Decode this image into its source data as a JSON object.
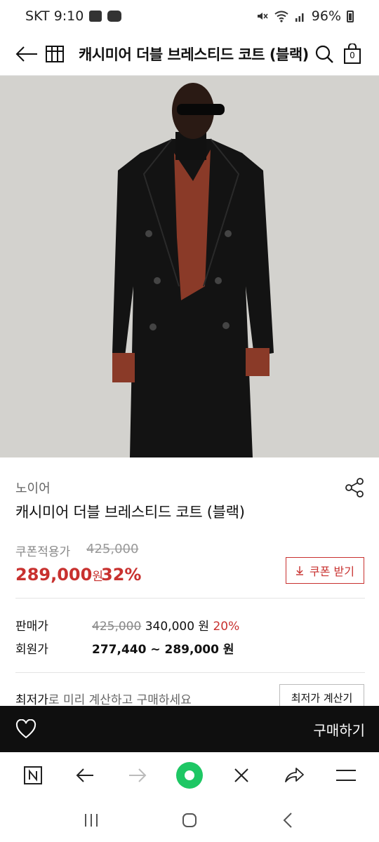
{
  "status_bar": {
    "carrier_time": "SKT 9:10",
    "battery": "96%"
  },
  "header": {
    "title": "캐시미어 더블 브레스티드 코트 (블랙)",
    "cart_count": "0"
  },
  "product": {
    "brand": "노이어",
    "name": "캐시미어 더블 브레스티드 코트 (블랙)",
    "coupon_label": "쿠폰적용가",
    "original_price": "425,000",
    "sale_price": "289,000",
    "sale_unit": "원",
    "discount_rate": "32%",
    "coupon_button": "쿠폰 받기"
  },
  "price_rows": {
    "sell_label": "판매가",
    "sell_original": "425,000",
    "sell_price": "340,000 원",
    "sell_discount": "20%",
    "member_label": "회원가",
    "member_range": "277,440 ~ 289,000 원"
  },
  "lowest": {
    "bold": "최저가",
    "rest": "로 미리 계산하고 구매하세요",
    "button": "최저가 계산기"
  },
  "buy_bar": {
    "buy_label": "구매하기"
  },
  "colors": {
    "accent_red": "#c8312f",
    "buy_bar_bg": "#0f0f0f",
    "browser_green": "#1ec764"
  }
}
